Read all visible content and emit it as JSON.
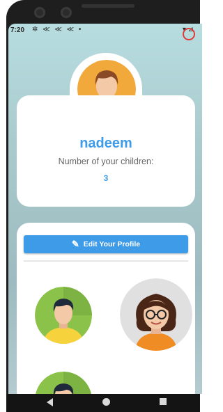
{
  "status_bar": {
    "time": "7:20",
    "left_icons": "✲ ≪ ≪ ≪ •",
    "right_icons": "▾ ⊿"
  },
  "profile": {
    "name": "nadeem",
    "children_label": "Number of your children:",
    "children_count": "3",
    "avatar": "man-avatar-icon"
  },
  "actions": {
    "edit_label": "Edit Your Profile",
    "edit_icon": "pencil-icon"
  },
  "children": [
    {
      "avatar": "boy-avatar-icon"
    },
    {
      "avatar": "girl-with-glasses-avatar-icon"
    },
    {
      "avatar": "boy-avatar-icon"
    }
  ],
  "colors": {
    "accent": "#3d9be8",
    "background_top": "#b7dde0",
    "card": "#ffffff"
  }
}
